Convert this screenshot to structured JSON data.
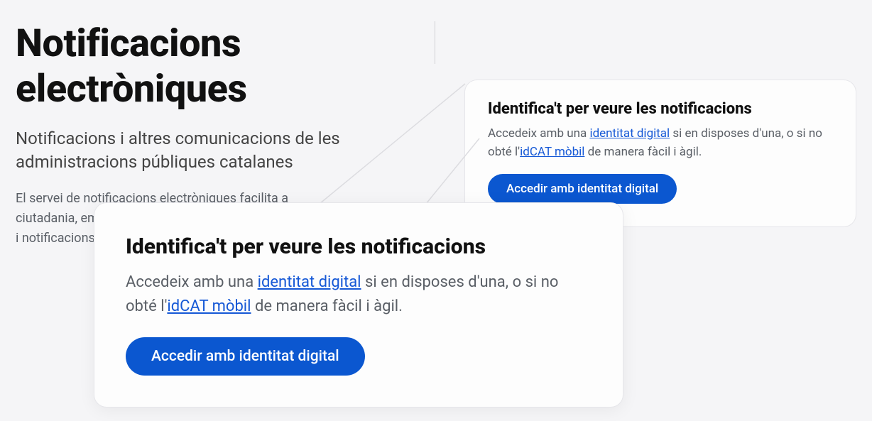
{
  "page": {
    "title": "Notificacions electròniques",
    "subtitle": "Notificacions i altres comunicacions de les administracions públiques catalanes",
    "body": "El servei de notificacions electròniques facilita a ciutadania, empreses i entitats la gestió de comunicacions i notificacions dels organismes públics adherits."
  },
  "card": {
    "title": "Identifica't per veure les notificacions",
    "text_pre": "Accedeix amb una ",
    "link1": "identitat digital",
    "text_mid": " si en disposes d'una, o si no obté l'",
    "link2": "idCAT mòbil",
    "text_post": " de manera fàcil i àgil.",
    "button": "Accedir amb identitat digital"
  }
}
